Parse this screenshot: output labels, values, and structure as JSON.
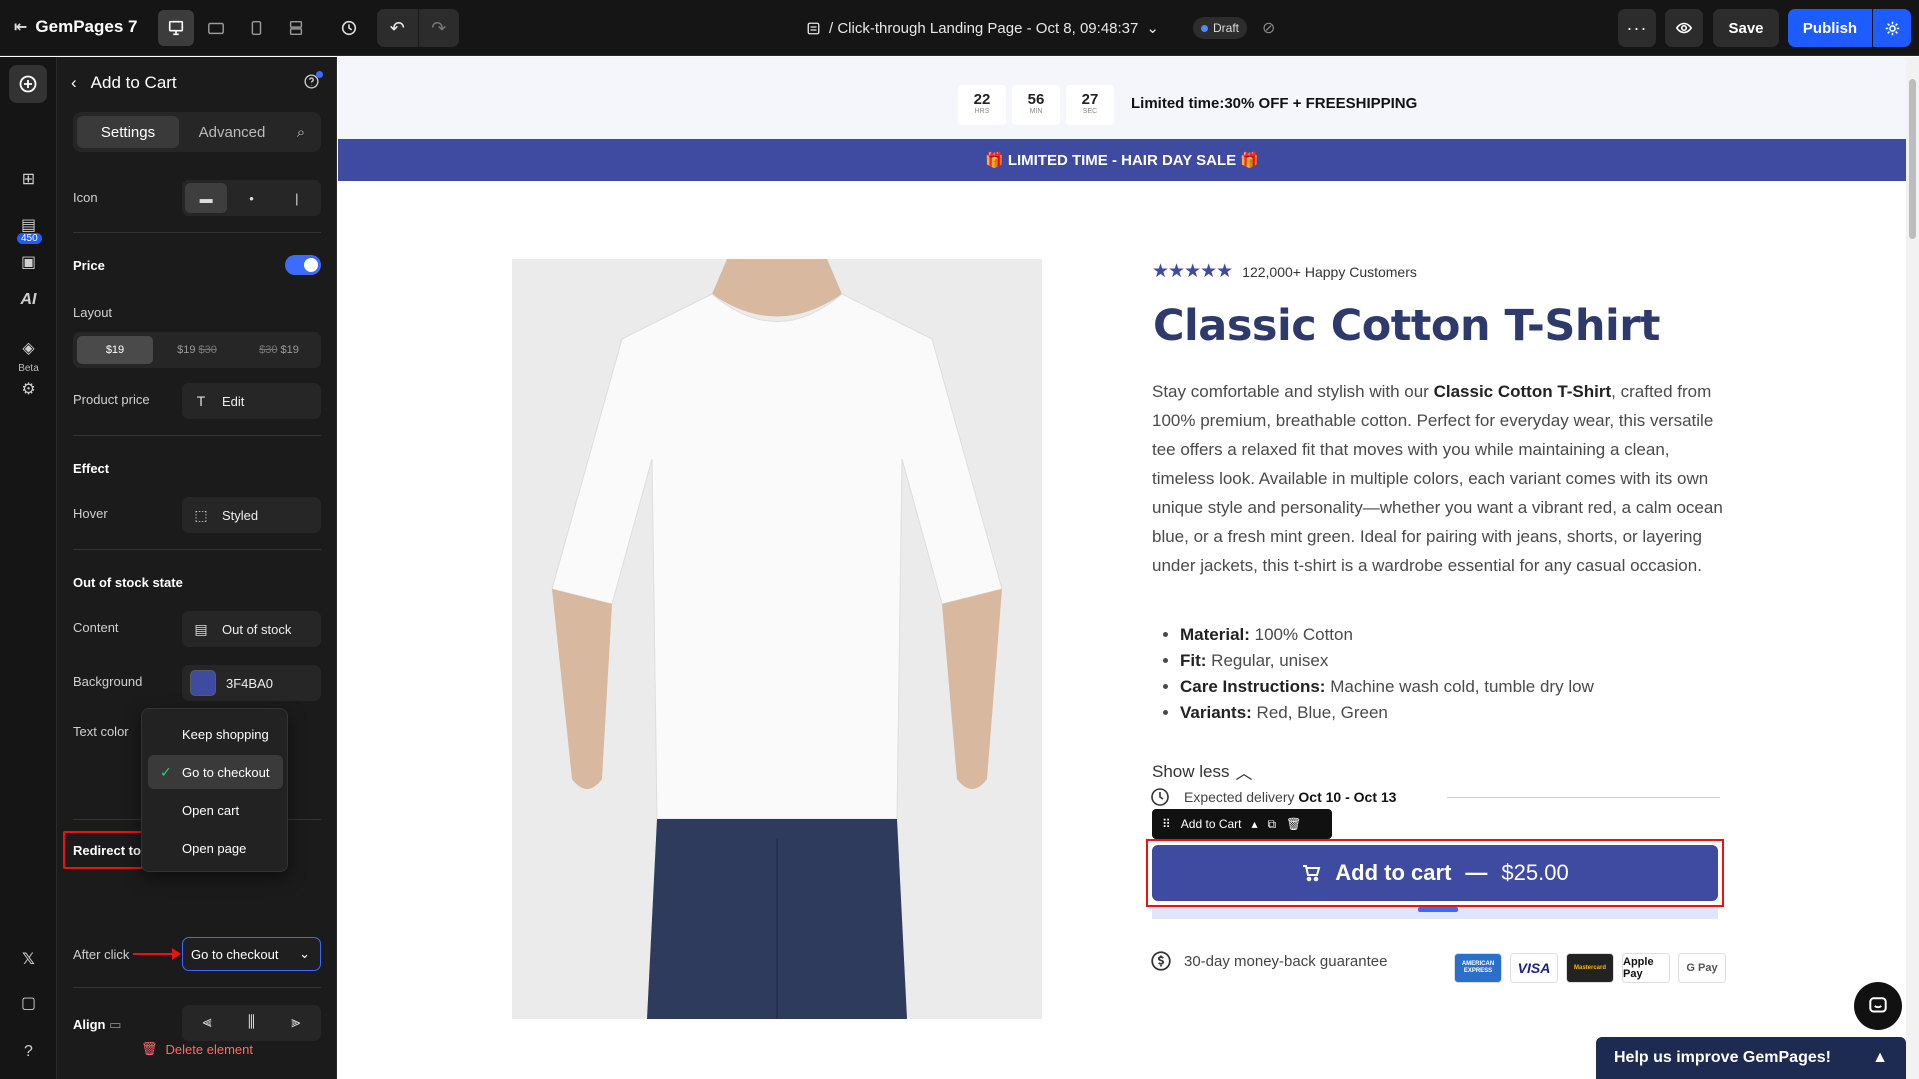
{
  "topbar": {
    "app_name": "GemPages 7",
    "page_title": "/ Click-through Landing Page - Oct 8, 09:48:37",
    "status": "Draft",
    "more_label": "···",
    "save_label": "Save",
    "publish_label": "Publish"
  },
  "rail": {
    "badge_count": "450",
    "ai_label": "AI",
    "beta_label": "Beta"
  },
  "panel": {
    "title": "Add to Cart",
    "tabs": [
      "Settings",
      "Advanced"
    ],
    "icon_label": "Icon",
    "price_section": "Price",
    "price_enabled": true,
    "layout_label": "Layout",
    "layout_options": [
      {
        "a": "$19",
        "b": ""
      },
      {
        "a": "$19",
        "b": "$30"
      },
      {
        "a": "$30",
        "b": "$19"
      }
    ],
    "product_price_label": "Product price",
    "product_price_value": "Edit",
    "effect_section": "Effect",
    "hover_label": "Hover",
    "hover_value": "Styled",
    "oos_section": "Out of stock state",
    "content_label": "Content",
    "content_value": "Out of stock",
    "background_label": "Background",
    "background_value": "3F4BA0",
    "background_color": "#3F4BA0",
    "textcolor_label": "Text color",
    "redirect_section": "Redirect to",
    "after_click_label": "After click",
    "after_click_value": "Go to checkout",
    "dropdown_options": [
      "Keep shopping",
      "Go to checkout",
      "Open cart",
      "Open page"
    ],
    "dropdown_selected": "Go to checkout",
    "align_label": "Align",
    "delete_label": "Delete element"
  },
  "canvas": {
    "countdown": [
      {
        "value": "22",
        "unit": "HRS"
      },
      {
        "value": "56",
        "unit": "MIN"
      },
      {
        "value": "27",
        "unit": "SEC"
      }
    ],
    "countdown_text": "Limited time:30% OFF + FREESHIPPING",
    "sale_banner": "🎁 LIMITED TIME - HAIR DAY SALE 🎁",
    "rating_text": "122,000+ Happy Customers",
    "product_title": "Classic Cotton T-Shirt",
    "description": {
      "before": "Stay comfortable and stylish with our ",
      "bold": "Classic Cotton T-Shirt",
      "after": ", crafted from 100% premium, breathable cotton. Perfect for everyday wear, this versatile tee offers a relaxed fit that moves with you while maintaining a clean, timeless look. Available in multiple colors, each variant comes with its own unique style and personality—whether you want a vibrant red, a calm ocean blue, or a fresh mint green. Ideal for pairing with jeans, shorts, or layering under jackets, this t-shirt is a wardrobe essential for any casual occasion."
    },
    "bullets": [
      {
        "label": "Material:",
        "value": " 100% Cotton"
      },
      {
        "label": "Fit:",
        "value": " Regular, unisex"
      },
      {
        "label": "Care Instructions:",
        "value": " Machine wash cold, tumble dry low"
      },
      {
        "label": "Variants:",
        "value": " Red, Blue, Green"
      }
    ],
    "show_less": "Show less",
    "delivery_prefix": "Expected delivery",
    "delivery_dates": "Oct 10 - Oct 13",
    "toolbar_label": "Add to Cart",
    "atc_label": "Add to cart",
    "atc_separator": "—",
    "atc_price": "$25.00",
    "guarantee": "30-day money-back guarantee",
    "cards": [
      "AMERICAN EXPRESS",
      "VISA",
      "Mastercard",
      "Apple Pay",
      "G Pay"
    ],
    "feedback": "Help us improve GemPages!"
  }
}
